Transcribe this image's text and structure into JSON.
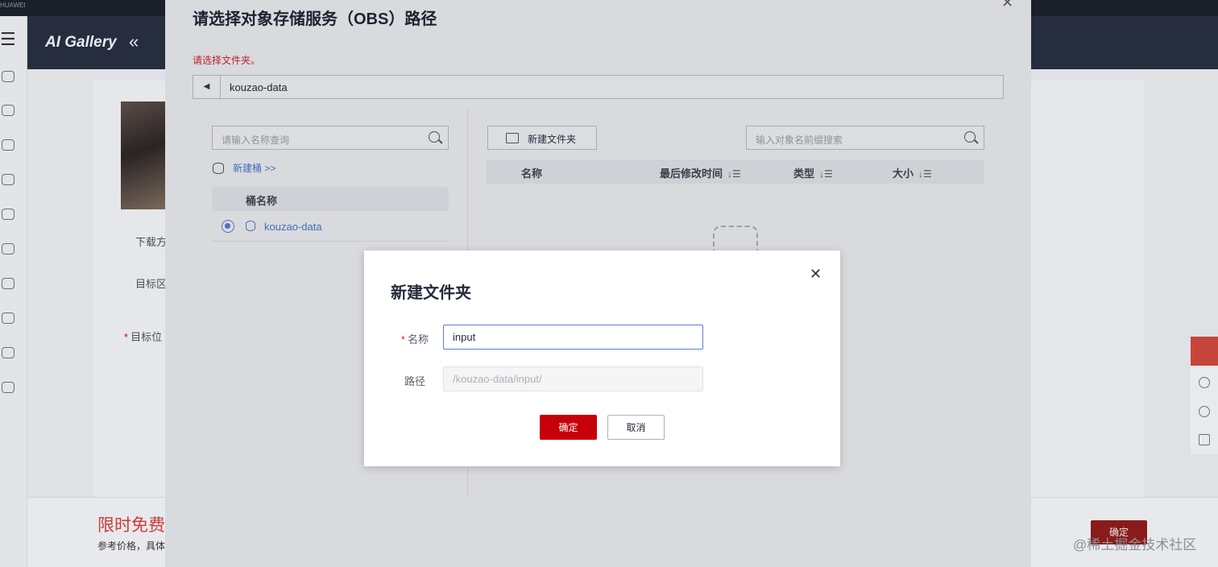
{
  "topbar": {
    "brand": "HUAWEI"
  },
  "header": {
    "logo": "AI Gallery",
    "collapse_icon": "«"
  },
  "background": {
    "download_label": "下载方",
    "region_label": "目标区",
    "target_label": "目标位",
    "required_mark": "*",
    "promo_title": "限时免费",
    "promo_sub": "参考价格，具体",
    "confirm_label": "确定",
    "watermark": "@稀土掘金技术社区"
  },
  "obs_dialog": {
    "title": "请选择对象存储服务（OBS）路径",
    "close_icon": "✕",
    "hint": "请选择文件夹。",
    "back_icon": "◀",
    "current_path": "kouzao-data",
    "bucket_search_placeholder": "请输入名称查询",
    "new_bucket_link": "新建桶 >>",
    "bucket_column": "桶名称",
    "buckets": [
      {
        "name": "kouzao-data",
        "selected": true
      }
    ],
    "new_folder_label": "新建文件夹",
    "object_search_placeholder": "输入对象名前缀搜索",
    "columns": {
      "name": "名称",
      "modified": "最后修改时间",
      "type": "类型",
      "size": "大小"
    },
    "sort_icon": "↓☰"
  },
  "new_folder_dialog": {
    "title": "新建文件夹",
    "close_icon": "✕",
    "name_label": "名称",
    "required_mark": "*",
    "name_value": "input",
    "path_label": "路径",
    "path_value": "/kouzao-data/input/",
    "ok_label": "确定",
    "cancel_label": "取消"
  },
  "colors": {
    "primary_red": "#c7000b",
    "link_blue": "#3f6fb8",
    "focus_blue": "#5e7ce0"
  }
}
